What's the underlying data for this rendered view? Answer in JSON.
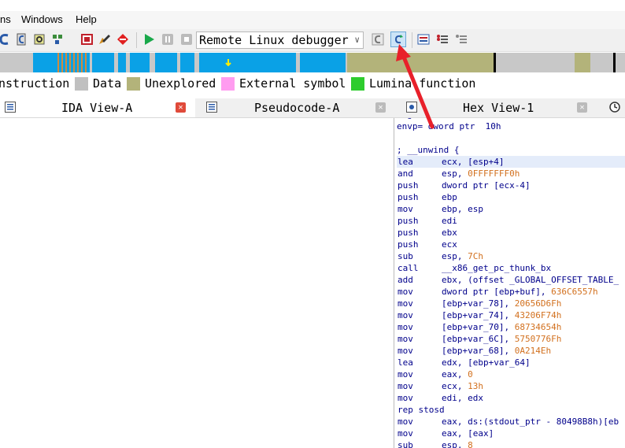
{
  "menubar": {
    "items": [
      "ns",
      "Windows",
      "Help"
    ]
  },
  "toolbar": {
    "debugger_select": "Remote Linux debugger",
    "icons": [
      "c-decompile-icon",
      "c-listing-icon",
      "q-icon",
      "graph-dropdown-icon",
      "breakpoint-icon",
      "edit-icon",
      "stop-sign-icon",
      "play-icon",
      "pause-icon",
      "stop-icon",
      "debugger-dropdown-icon",
      "c-view-icon",
      "c-refresh-icon",
      "list-icon",
      "list-bullets-icon",
      "list-gray-icon"
    ]
  },
  "legend": {
    "items": [
      {
        "label": "nstruction",
        "color": "#ffffff"
      },
      {
        "label": "Data",
        "color": "#c0c0c0"
      },
      {
        "label": "Unexplored",
        "color": "#b3b37a"
      },
      {
        "label": "External symbol",
        "color": "#ff9cf0"
      },
      {
        "label": "Lumina function",
        "color": "#2ecc2e"
      }
    ]
  },
  "tabs": {
    "ida_view": "IDA View-A",
    "pseudocode": "Pseudocode-A",
    "hex_view": "Hex View-1"
  },
  "asm": {
    "header_partial": "envp= dword ptr  10h",
    "unwind": "; __unwind {",
    "lines": [
      {
        "mn": "lea",
        "op": "ecx, [esp+4]"
      },
      {
        "mn": "and",
        "op": "esp, 0FFFFFFF0h"
      },
      {
        "mn": "push",
        "op": "dword ptr [ecx-4]"
      },
      {
        "mn": "push",
        "op": "ebp"
      },
      {
        "mn": "mov",
        "op": "ebp, esp"
      },
      {
        "mn": "push",
        "op": "edi"
      },
      {
        "mn": "push",
        "op": "ebx"
      },
      {
        "mn": "push",
        "op": "ecx"
      },
      {
        "mn": "sub",
        "op": "esp, 7Ch"
      },
      {
        "mn": "call",
        "op": "__x86_get_pc_thunk_bx"
      },
      {
        "mn": "add",
        "op": "ebx, (offset _GLOBAL_OFFSET_TABLE_"
      },
      {
        "mn": "mov",
        "op": "dword ptr [ebp+buf], 636C6557h"
      },
      {
        "mn": "mov",
        "op": "[ebp+var_78], 20656D6Fh"
      },
      {
        "mn": "mov",
        "op": "[ebp+var_74], 43206F74h"
      },
      {
        "mn": "mov",
        "op": "[ebp+var_70], 68734654h"
      },
      {
        "mn": "mov",
        "op": "[ebp+var_6C], 5750776Fh"
      },
      {
        "mn": "mov",
        "op": "[ebp+var_68], 0A214Eh"
      },
      {
        "mn": "lea",
        "op": "edx, [ebp+var_64]"
      },
      {
        "mn": "mov",
        "op": "eax, 0"
      },
      {
        "mn": "mov",
        "op": "ecx, 13h"
      },
      {
        "mn": "mov",
        "op": "edi, edx"
      },
      {
        "mn": "rep stosd",
        "op": ""
      },
      {
        "mn": "mov",
        "op": "eax, ds:(stdout_ptr - 80498B8h)[eb"
      },
      {
        "mn": "mov",
        "op": "eax, [eax]"
      },
      {
        "mn": "sub",
        "op": "esp, 8"
      }
    ]
  },
  "colors": {
    "instruction_blue": "#0aa1e6",
    "unexplored": "#b3b37a",
    "data_gray": "#c0c0c0",
    "arrow_red": "#e8202a"
  }
}
